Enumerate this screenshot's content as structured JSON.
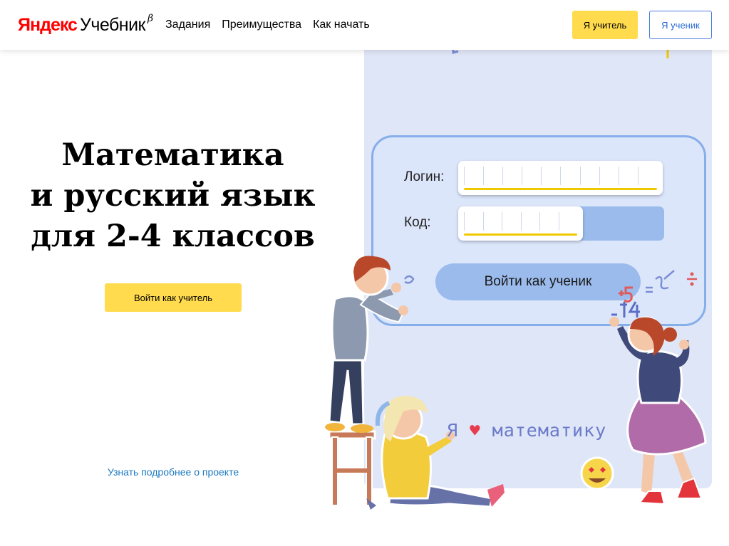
{
  "header": {
    "logo": {
      "yandex": "Яндекс",
      "product": "Учебник",
      "beta": "β"
    },
    "nav": [
      "Задания",
      "Преимущества",
      "Как начать"
    ],
    "teacher_button": "Я учитель",
    "student_button": "Я ученик"
  },
  "hero": {
    "title_lines": [
      "Математика",
      "и русский язык",
      "для 2-4 классов"
    ],
    "teacher_login_button": "Войти как учитель",
    "learn_more_link": "Узнать подробнее о проекте"
  },
  "login_board": {
    "login_label": "Логин:",
    "code_label": "Код:",
    "login_value": "",
    "code_value": "",
    "submit_button": "Войти как ученик"
  },
  "illustration": {
    "chalk_text_left": "Я",
    "chalk_text_right": "математику",
    "heart_icon": "♥"
  },
  "colors": {
    "accent_yellow": "#ffdb4d",
    "link_blue": "#1c79c0",
    "board_blue": "#86aeea",
    "panel_bg": "#dfe6f7"
  }
}
